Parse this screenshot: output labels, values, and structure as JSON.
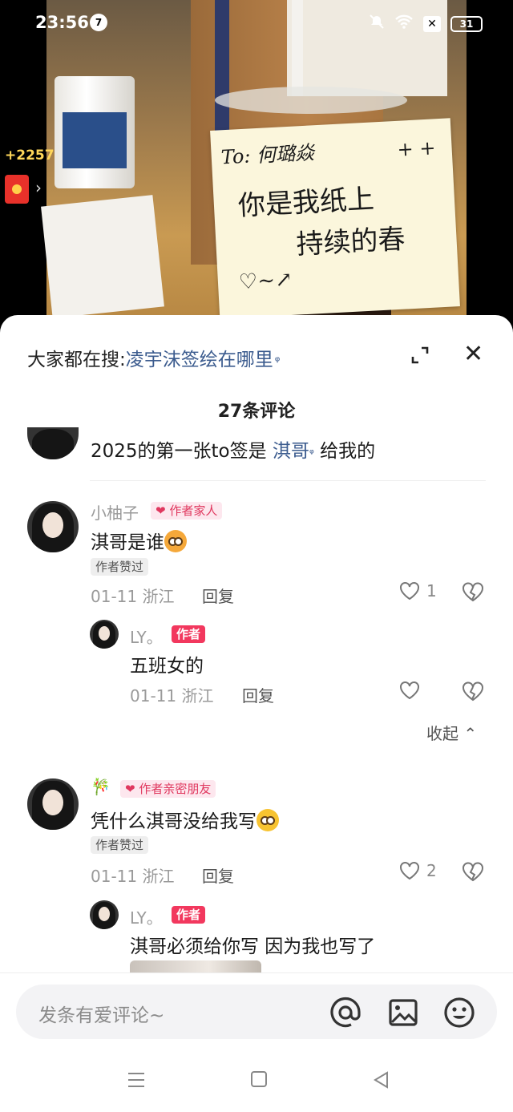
{
  "status_bar": {
    "time": "23:56",
    "notification_count": "7",
    "battery": "31"
  },
  "overlay": {
    "coins": "+2257"
  },
  "photo": {
    "note_lines": [
      "To: 何璐焱",
      "你是我纸上",
      "持续的春"
    ]
  },
  "sheet": {
    "search_prefix": "大家都在搜:",
    "search_term": "凌宇沫签绘在哪里",
    "comment_count": "27条评论",
    "collapse_label": "收起",
    "comments": [
      {
        "text_before": "2025的第一张to签是 ",
        "link": "淇哥",
        "text_after": " 给我的"
      },
      {
        "username": "小柚子",
        "badge": "作者家人",
        "text": "淇哥是谁",
        "liked_label": "作者赞过",
        "date": "01-11",
        "location": "浙江",
        "reply": "回复",
        "likes": "1"
      },
      {
        "username": "LY。",
        "badge": "作者",
        "text": "五班女的",
        "date": "01-11",
        "location": "浙江",
        "reply": "回复"
      },
      {
        "username": "🎋",
        "badge": "作者亲密朋友",
        "text": "凭什么淇哥没给我写",
        "liked_label": "作者赞过",
        "date": "01-11",
        "location": "浙江",
        "reply": "回复",
        "likes": "2"
      },
      {
        "username": "LY。",
        "badge": "作者",
        "text": "淇哥必须给你写 因为我也写了"
      }
    ],
    "input_placeholder": "发条有爱评论~"
  },
  "colors": {
    "accent_link": "#3b5b8e",
    "badge_red": "#f2385e",
    "badge_pink_bg": "#fde7ee"
  }
}
